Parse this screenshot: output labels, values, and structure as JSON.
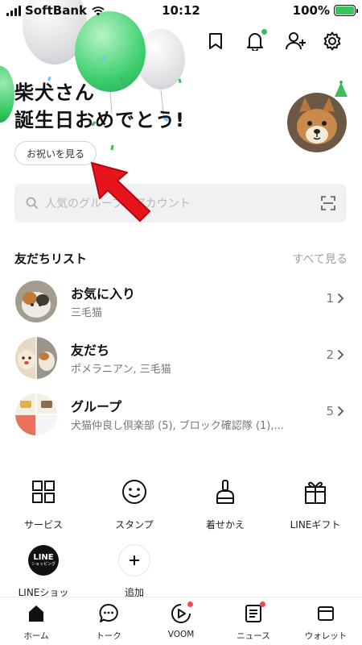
{
  "status_bar": {
    "carrier": "SoftBank",
    "time": "10:12",
    "battery": "100%"
  },
  "colors": {
    "accent_green": "#06c755",
    "badge_green": "#3dbb59",
    "badge_red": "#f04a4a",
    "arrow_red": "#e8141b"
  },
  "header_icons": [
    "bookmark-icon",
    "bell-icon",
    "add-friend-icon",
    "settings-icon"
  ],
  "birthday": {
    "line1": "柴犬さん",
    "line2": "誕生日おめでとう!",
    "button": "お祝いを見る"
  },
  "search": {
    "placeholder": "人気のグループ、アカウント"
  },
  "friends": {
    "title": "友だちリスト",
    "see_all": "すべて見る",
    "rows": [
      {
        "name": "お気に入り",
        "sub": "三毛猫",
        "count": "1"
      },
      {
        "name": "友だち",
        "sub": "ポメラニアン, 三毛猫",
        "count": "2"
      },
      {
        "name": "グループ",
        "sub": "犬猫仲良し倶楽部 (5), ブロック確認隊 (1),...",
        "count": "5"
      }
    ]
  },
  "services": [
    {
      "label": "サービス",
      "icon": "grid-icon"
    },
    {
      "label": "スタンプ",
      "icon": "smile-icon"
    },
    {
      "label": "着せかえ",
      "icon": "brush-icon"
    },
    {
      "label": "LINEギフト",
      "icon": "gift-icon"
    },
    {
      "label": "LINEショッ",
      "icon": "line-shopping-icon",
      "badge_text": "LINE",
      "badge_sub": "ショッピング"
    },
    {
      "label": "追加",
      "icon": "plus-icon"
    }
  ],
  "tabs": [
    {
      "label": "ホーム",
      "icon": "home-icon",
      "active": true
    },
    {
      "label": "トーク",
      "icon": "chat-icon"
    },
    {
      "label": "VOOM",
      "icon": "voom-icon"
    },
    {
      "label": "ニュース",
      "icon": "news-icon"
    },
    {
      "label": "ウォレット",
      "icon": "wallet-icon"
    }
  ]
}
